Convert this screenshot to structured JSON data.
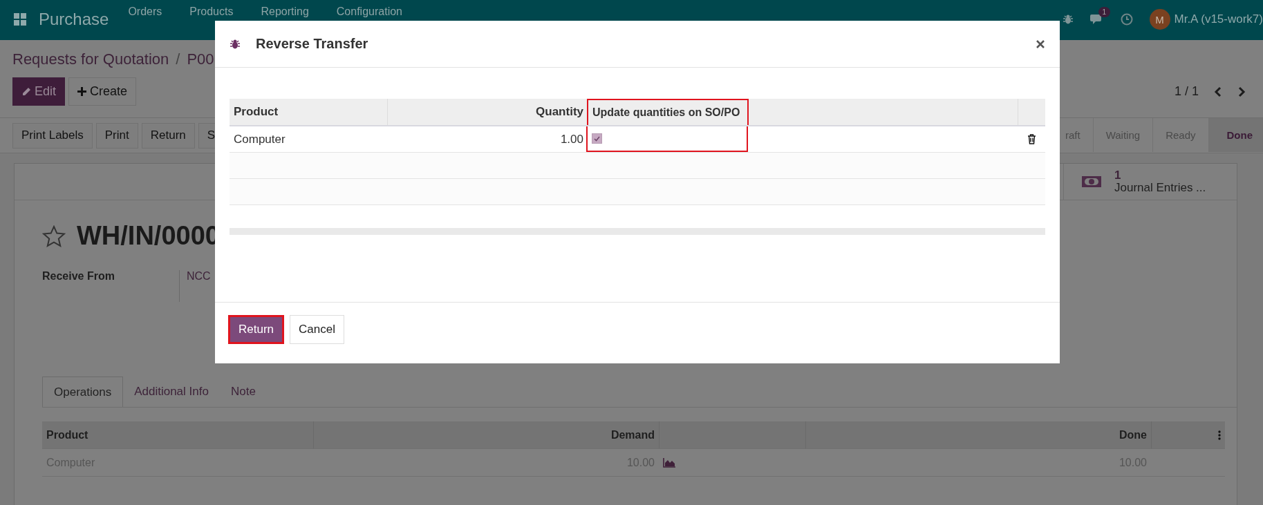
{
  "navbar": {
    "app_name": "Purchase",
    "menu": [
      "Orders",
      "Products",
      "Reporting",
      "Configuration"
    ],
    "chat_badge": "1",
    "avatar_initial": "M",
    "user": "Mr.A (v15-work7)"
  },
  "breadcrumb": {
    "parent": "Requests for Quotation",
    "separator": "/",
    "current": "P00"
  },
  "control_buttons": [
    {
      "label": "Edit",
      "kind": "primary"
    },
    {
      "label": "Create",
      "kind": "secondary"
    }
  ],
  "pager": "1 / 1",
  "action_buttons": [
    "Print Labels",
    "Print",
    "Return",
    "S"
  ],
  "statusbar": [
    {
      "label": "raft",
      "selected": false
    },
    {
      "label": "Waiting",
      "selected": false
    },
    {
      "label": "Ready",
      "selected": false
    },
    {
      "label": "Done",
      "selected": true
    }
  ],
  "smart_button": {
    "count": "1",
    "label": "Journal Entries ..."
  },
  "record": {
    "title": "WH/IN/0000",
    "starred": false,
    "fields": [
      {
        "label": "Receive From",
        "value": "NCC"
      }
    ]
  },
  "tabs": [
    {
      "label": "Operations",
      "selected": true
    },
    {
      "label": "Additional Info",
      "selected": false
    },
    {
      "label": "Note",
      "selected": false
    }
  ],
  "operations": {
    "columns": [
      "Product",
      "Demand",
      "Done"
    ],
    "rows": [
      {
        "product": "Computer",
        "demand": "10.00",
        "done": "10.00"
      }
    ]
  },
  "dialog": {
    "title": "Reverse Transfer",
    "columns": [
      {
        "label": "Product",
        "highlighted": false
      },
      {
        "label": "Quantity",
        "highlighted": false
      },
      {
        "label": "Update quantities on SO/PO",
        "highlighted": true
      }
    ],
    "rows": [
      {
        "product": "Computer",
        "quantity": "1.00",
        "update_quantities": true
      }
    ],
    "buttons": [
      {
        "label": "Return",
        "kind": "primary",
        "highlighted": true
      },
      {
        "label": "Cancel",
        "kind": "secondary",
        "highlighted": false
      }
    ]
  }
}
